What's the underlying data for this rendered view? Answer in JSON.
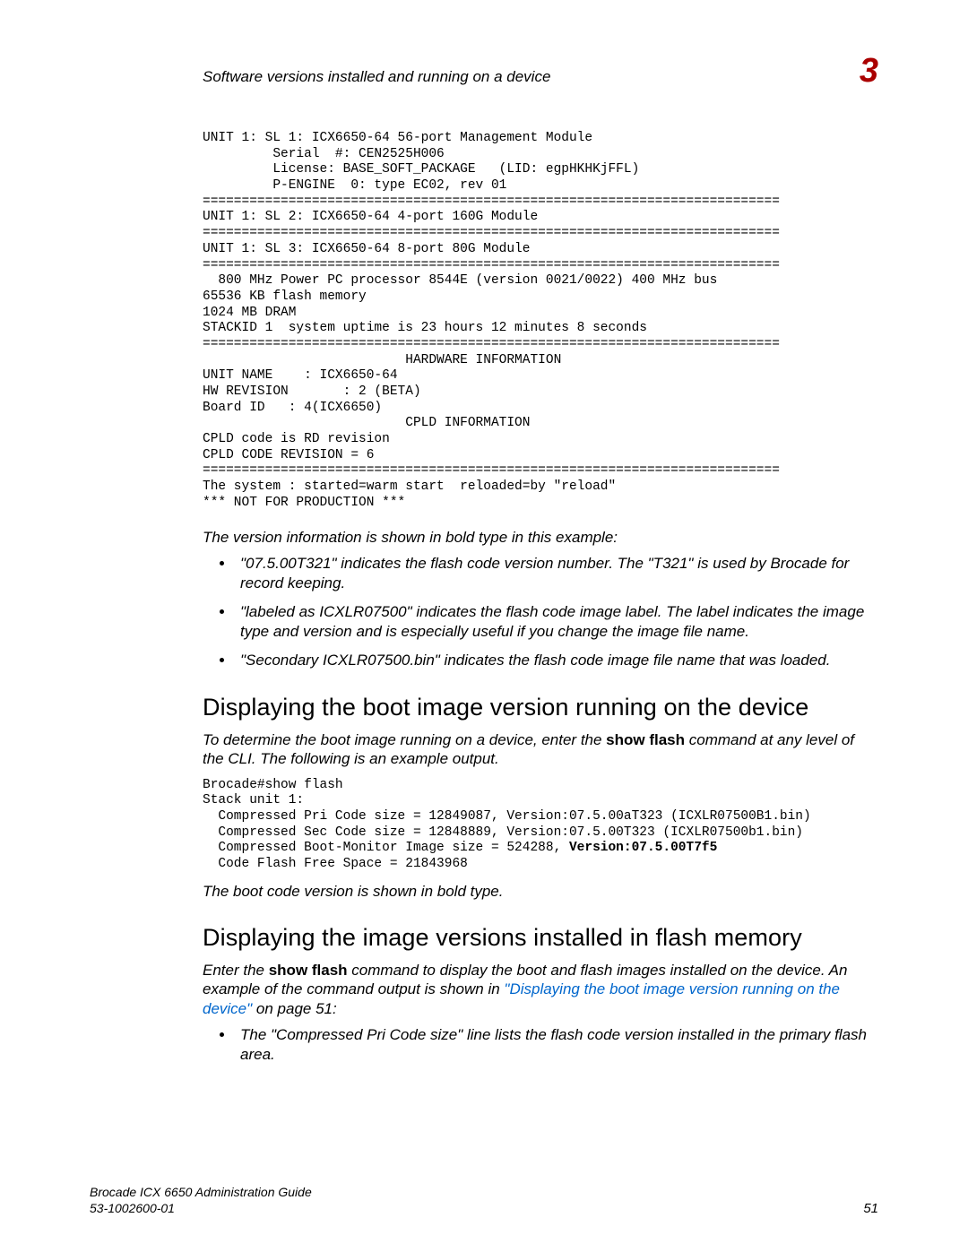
{
  "header": {
    "title": "Software versions installed and running on a device",
    "chapter": "3"
  },
  "code1": "UNIT 1: SL 1: ICX6650-64 56-port Management Module\n         Serial  #: CEN2525H006\n         License: BASE_SOFT_PACKAGE   (LID: egpHKHKjFFL)\n         P-ENGINE  0: type EC02, rev 01\n==========================================================================\nUNIT 1: SL 2: ICX6650-64 4-port 160G Module\n==========================================================================\nUNIT 1: SL 3: ICX6650-64 8-port 80G Module\n==========================================================================\n  800 MHz Power PC processor 8544E (version 0021/0022) 400 MHz bus\n65536 KB flash memory\n1024 MB DRAM\nSTACKID 1  system uptime is 23 hours 12 minutes 8 seconds\n==========================================================================\n                          HARDWARE INFORMATION\nUNIT NAME    : ICX6650-64\nHW REVISION       : 2 (BETA)\nBoard ID   : 4(ICX6650)\n                          CPLD INFORMATION\nCPLD code is RD revision\nCPLD CODE REVISION = 6\n==========================================================================\nThe system : started=warm start  reloaded=by \"reload\"\n*** NOT FOR PRODUCTION ***",
  "para1": "The version information is shown in bold type in this example:",
  "bullets1": [
    "\"07.5.00T321\" indicates the flash code version number. The \"T321\" is used by Brocade for record keeping.",
    "\"labeled as ICXLR07500\" indicates the flash code image label. The label indicates the image type and version and is especially useful if you change the image file name.",
    "\"Secondary ICXLR07500.bin\" indicates the flash code image file name that was loaded."
  ],
  "h2a": "Displaying the boot image version running on the device",
  "para2_pre": "To determine the boot image running on a device, enter the ",
  "para2_cmd": "show flash",
  "para2_post": " command at any level of the CLI. The following is an example output.",
  "code2_prefix": "Brocade#show flash\nStack unit 1:\n  Compressed Pri Code size = 12849087, Version:07.5.00aT323 (ICXLR07500B1.bin)\n  Compressed Sec Code size = 12848889, Version:07.5.00T323 (ICXLR07500b1.bin)\n  Compressed Boot-Monitor Image size = 524288, ",
  "code2_bold": "Version:07.5.00T7f5",
  "code2_suffix": "\n  Code Flash Free Space = 21843968",
  "para3": "The boot code version is shown in bold type.",
  "h2b": "Displaying the image versions installed in flash memory",
  "para4_pre": "Enter the ",
  "para4_cmd": "show flash",
  "para4_mid": " command to display the boot and flash images installed on the device. An example of the command output is shown in ",
  "para4_link": "\"Displaying the boot image version running on the device\"",
  "para4_post": " on page 51:",
  "bullets2": [
    "The \"Compressed Pri Code size\" line lists the flash code version installed in the primary flash area."
  ],
  "footer": {
    "book": "Brocade ICX 6650 Administration Guide",
    "docnum": "53-1002600-01",
    "page": "51"
  }
}
